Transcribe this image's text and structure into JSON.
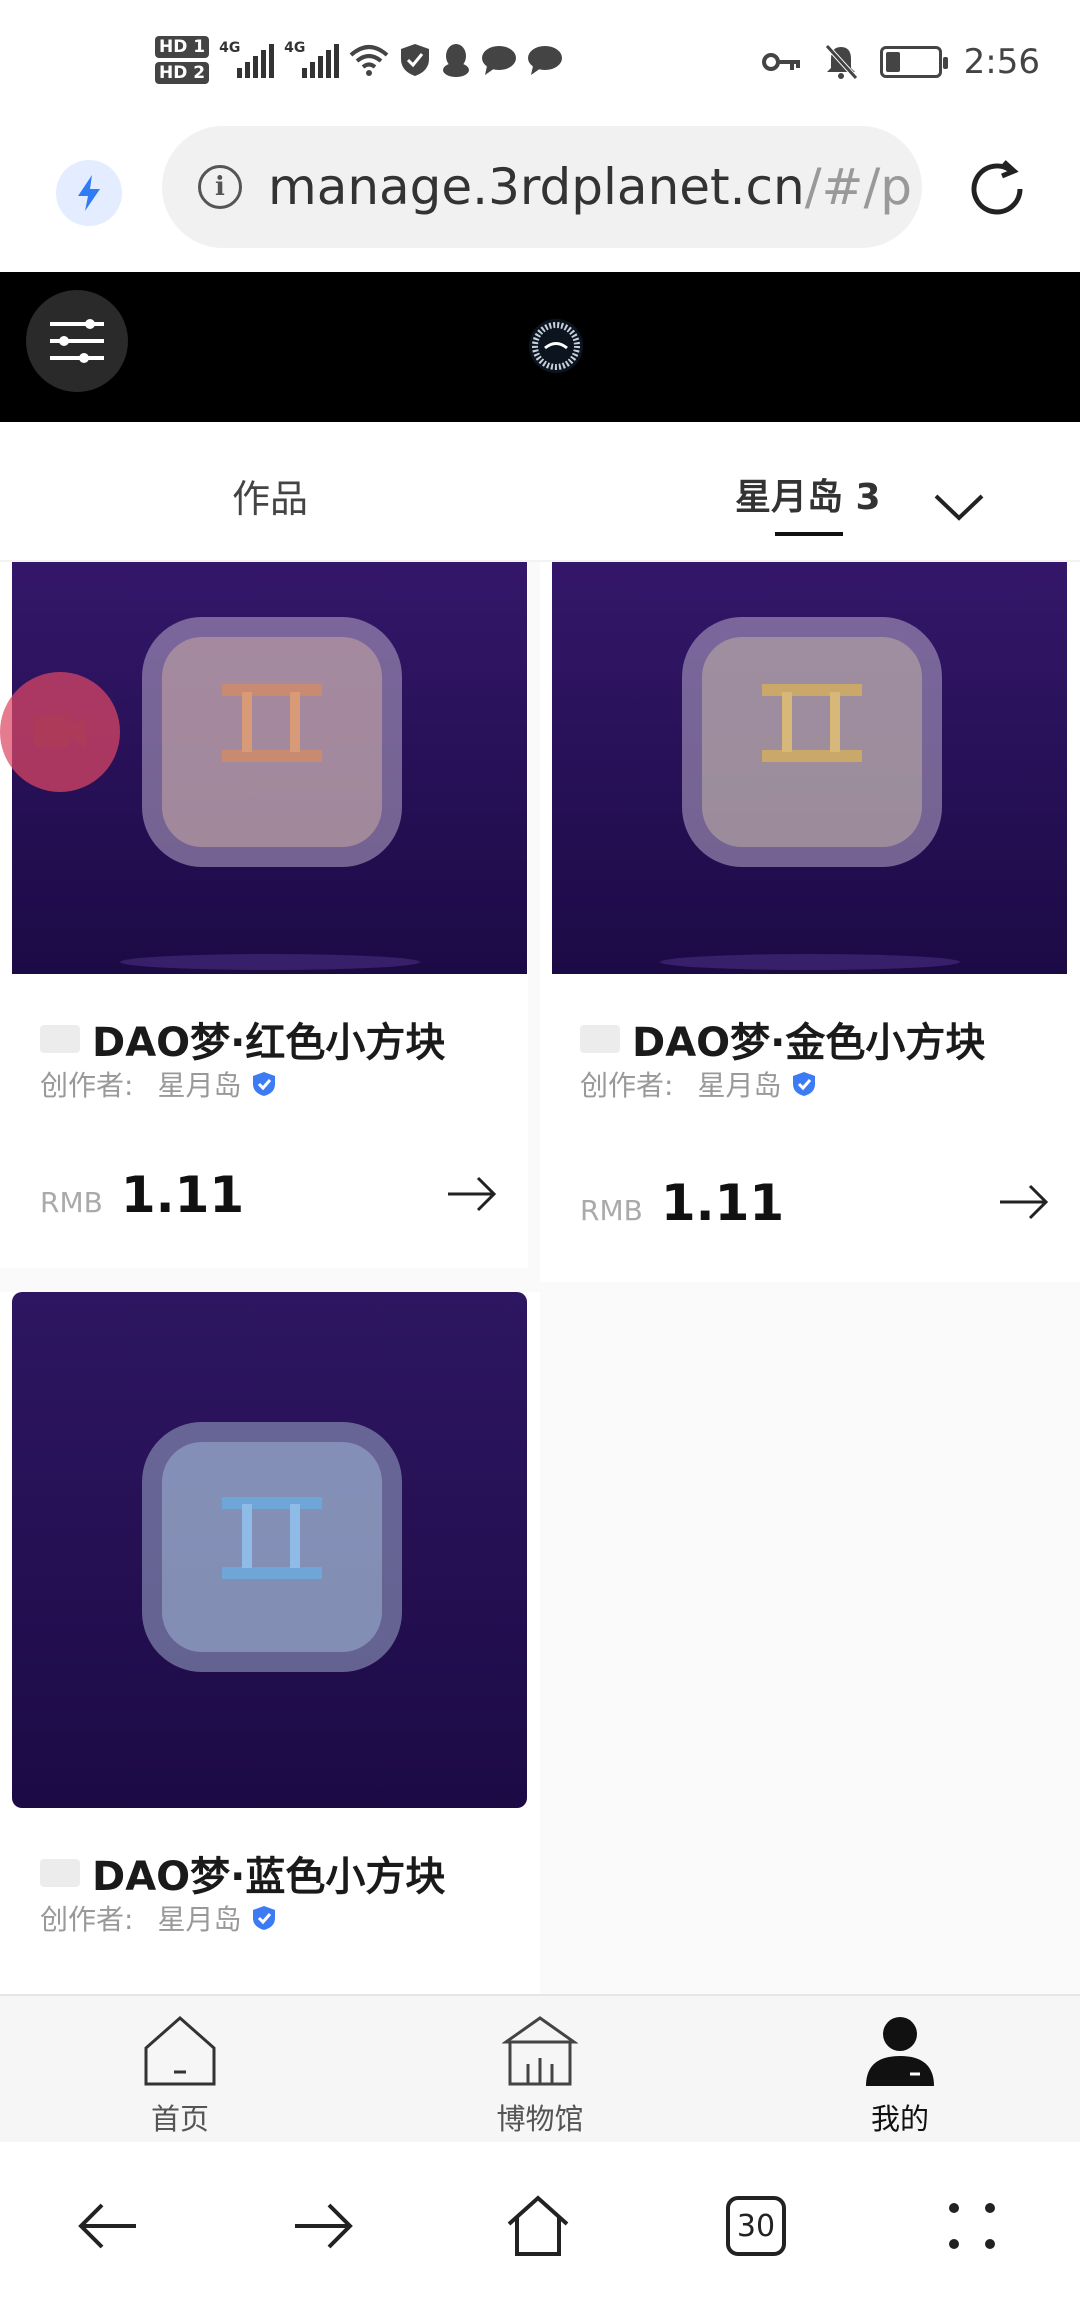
{
  "status_bar": {
    "hd1": "HD 1",
    "hd2": "HD 2",
    "net1": "4G",
    "net2": "4G",
    "time": "2:56"
  },
  "browser": {
    "url_main": "manage.3rdplanet.cn",
    "url_rest": "/#/p",
    "tab_count": "30"
  },
  "tabs": {
    "works": "作品",
    "island": "星月岛 3"
  },
  "cards": [
    {
      "name": "DAO梦·红色小方块",
      "creator_label": "创作者:",
      "creator": "星月岛",
      "currency": "RMB",
      "price": "1.11",
      "tint": "#c88a70"
    },
    {
      "name": "DAO梦·金色小方块",
      "creator_label": "创作者:",
      "creator": "星月岛",
      "currency": "RMB",
      "price": "1.11",
      "tint": "#c9a86a"
    },
    {
      "name": "DAO梦·蓝色小方块",
      "creator_label": "创作者:",
      "creator": "星月岛",
      "tint": "#6fa6d8"
    }
  ],
  "app_nav": {
    "home": "首页",
    "museum": "博物馆",
    "mine": "我的"
  },
  "colors": {
    "card_bg": "#2b1357",
    "verify": "#3d7bf5",
    "fab": "#dc4664"
  }
}
